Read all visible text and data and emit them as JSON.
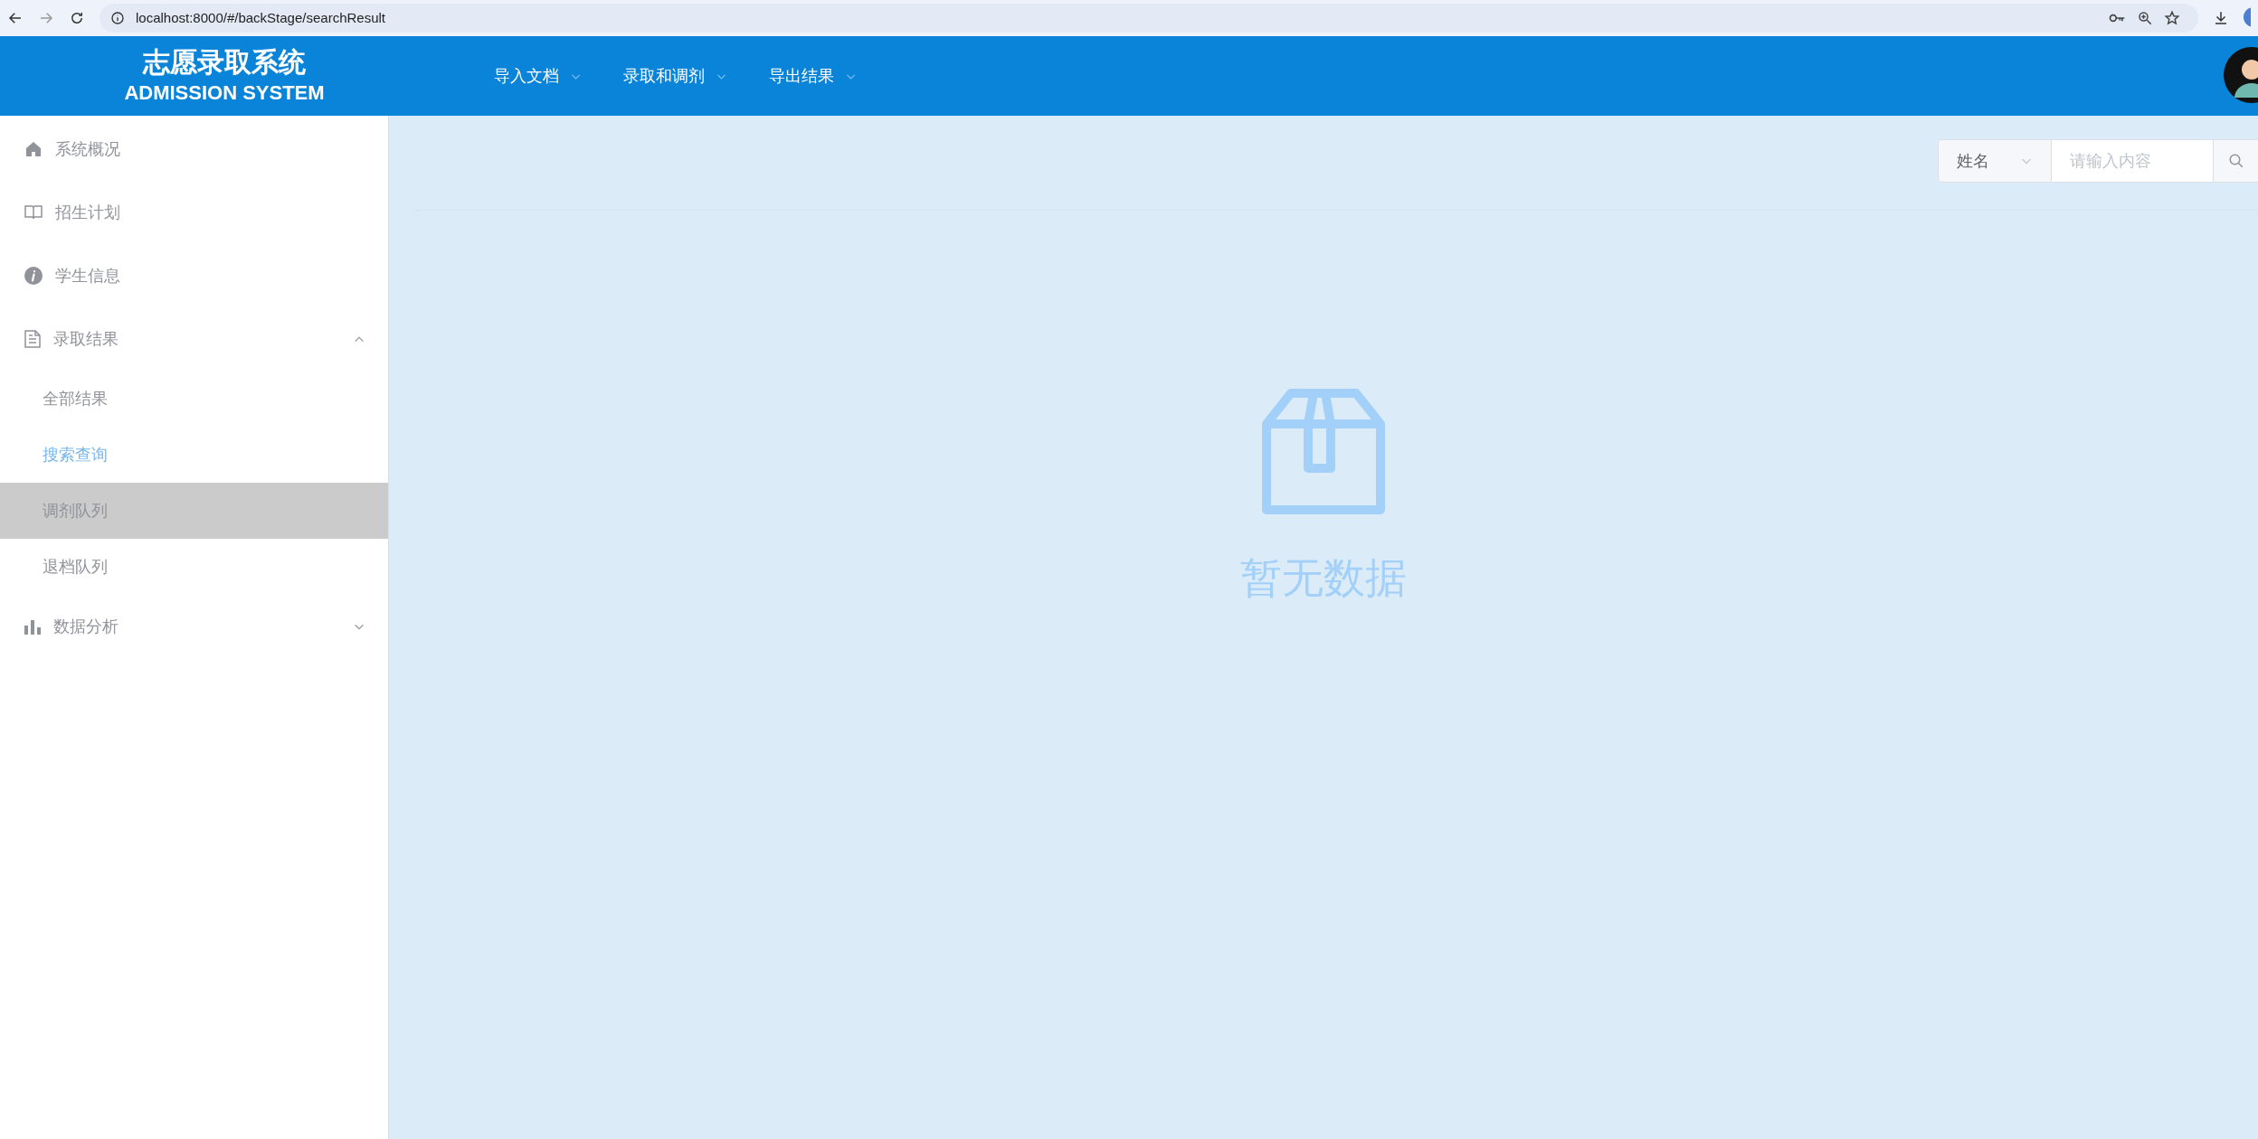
{
  "browser": {
    "url": "localhost:8000/#/backStage/searchResult"
  },
  "header": {
    "title": "志愿录取系统",
    "subtitle": "ADMISSION SYSTEM",
    "nav": [
      {
        "label": "导入文档"
      },
      {
        "label": "录取和调剂"
      },
      {
        "label": "导出结果"
      }
    ]
  },
  "sidebar": {
    "items": [
      {
        "label": "系统概况",
        "kind": "home"
      },
      {
        "label": "招生计划",
        "kind": "book"
      },
      {
        "label": "学生信息",
        "kind": "info"
      },
      {
        "label": "录取结果",
        "kind": "document",
        "expanded": true,
        "children": [
          {
            "label": "全部结果",
            "selected": false,
            "hovered": false
          },
          {
            "label": "搜索查询",
            "selected": true,
            "hovered": false
          },
          {
            "label": "调剂队列",
            "selected": false,
            "hovered": true
          },
          {
            "label": "退档队列",
            "selected": false,
            "hovered": false
          }
        ]
      },
      {
        "label": "数据分析",
        "kind": "chart",
        "expanded": false
      }
    ]
  },
  "search": {
    "field": "姓名",
    "placeholder": "请输入内容"
  },
  "empty": {
    "text": "暂无数据"
  }
}
